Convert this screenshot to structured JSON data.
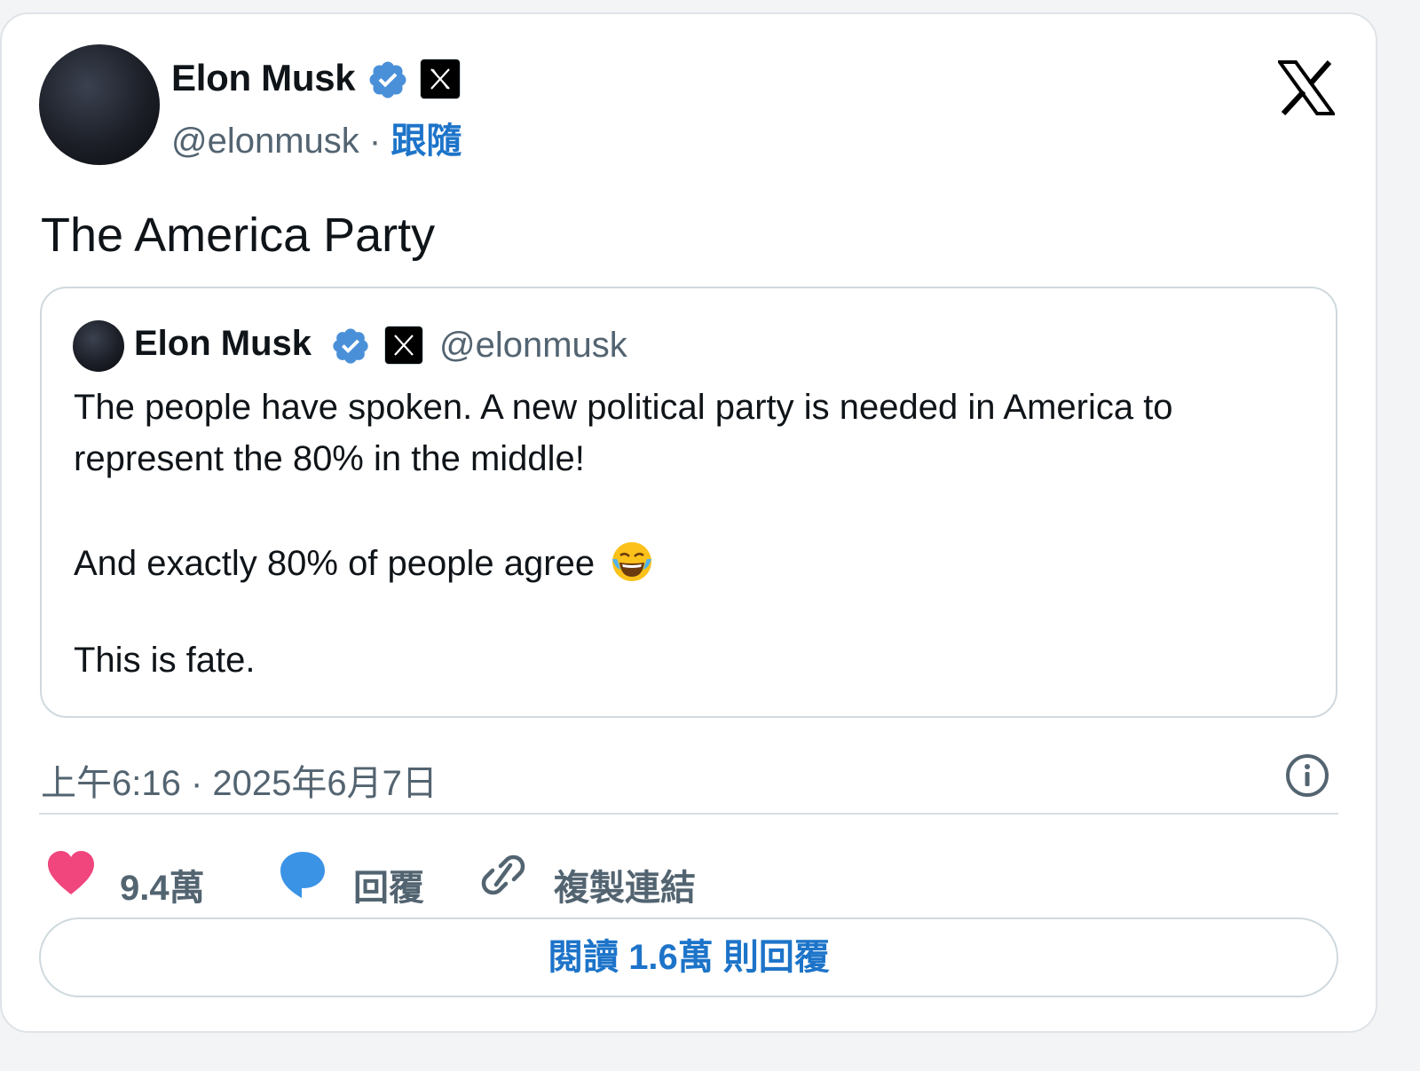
{
  "author": {
    "name": "Elon Musk",
    "handle": "@elonmusk",
    "separator": "·",
    "follow_label": "跟隨"
  },
  "tweet": {
    "text": "The America Party"
  },
  "quoted_tweet": {
    "author_name": "Elon Musk",
    "author_handle": "@elonmusk",
    "lines": [
      "The people have spoken. A new political party is needed in America to",
      "represent the 80% in the middle!",
      "And exactly 80% of people agree",
      "This is fate."
    ],
    "emoji": "face-with-tears-of-joy"
  },
  "timestamp": "上午6:16 · 2025年6月7日",
  "actions": {
    "likes": "9.4萬",
    "reply_label": "回覆",
    "copy_link_label": "複製連結"
  },
  "read_replies_label": "閱讀 1.6萬 則回覆",
  "colors": {
    "verified": "#4a90d9",
    "link": "#1d74c9",
    "heart": "#f0467d",
    "reply_bubble": "#3b93e6",
    "secondary_text": "#536471"
  },
  "icons": [
    "verified-badge-icon",
    "x-affiliation-badge-icon",
    "x-logo-icon",
    "info-icon",
    "heart-icon",
    "reply-bubble-icon",
    "link-icon"
  ]
}
